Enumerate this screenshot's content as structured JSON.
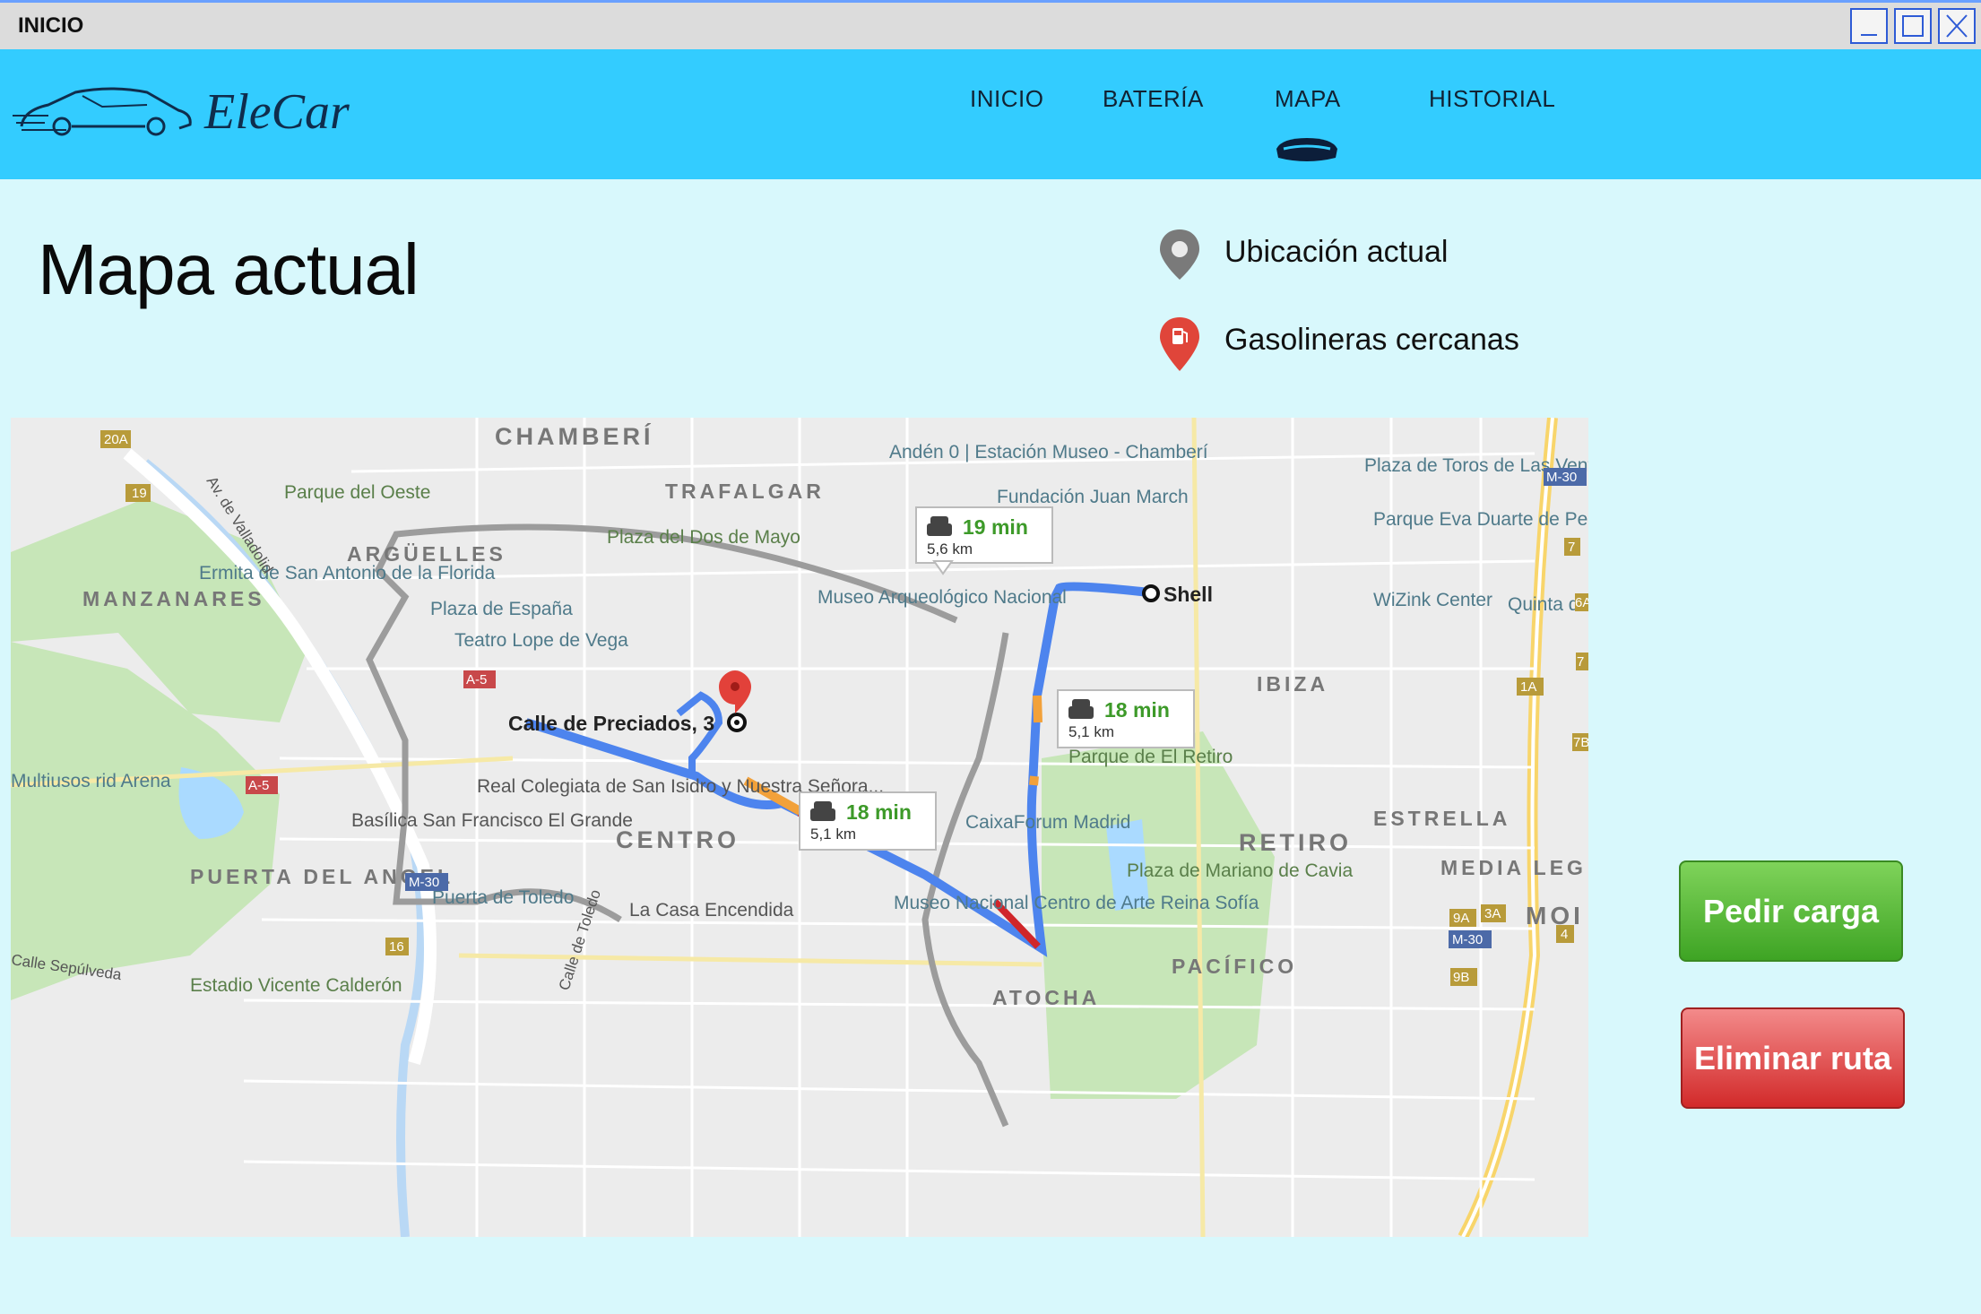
{
  "window": {
    "title": "INICIO"
  },
  "header": {
    "brand": "EleCar",
    "nav": [
      "INICIO",
      "BATERÍA",
      "MAPA",
      "HISTORIAL"
    ],
    "active_nav": "MAPA"
  },
  "page": {
    "title": "Mapa actual"
  },
  "legend": [
    {
      "label": "Ubicación actual",
      "icon": "gray-map-pin-icon"
    },
    {
      "label": "Gasolineras cercanas",
      "icon": "red-gas-station-pin-icon"
    }
  ],
  "map": {
    "districts": [
      "CHAMBERÍ",
      "TRAFALGAR",
      "ARGÜELLES",
      "MANZANARES",
      "CENTRO",
      "PUERTA DEL ANGEL",
      "IBIZA",
      "ESTRELLA",
      "RETIRO",
      "MEDIA LEG",
      "PACÍFICO",
      "ATOCHA",
      "MOI"
    ],
    "places": [
      "Andén 0 | Estación Museo - Chamberí",
      "Fundación Juan March",
      "Plaza de Toros de Las Ventas",
      "Parque Eva Duarte de Perón",
      "Parque del Oeste",
      "Ermita de San Antonio de la Florida",
      "Plaza del Dos de Mayo",
      "Museo Arqueológico Nacional",
      "WiZink Center",
      "Quinta d la Fuent del Berr",
      "Plaza de España",
      "Teatro Lope de Vega",
      "Parque de El Retiro",
      "Real Colegiata de San Isidro y Nuestra Señora...",
      "Basílica San Francisco El Grande",
      "CaixaForum Madrid",
      "Multiusos rid Arena",
      "Puerta de Toledo",
      "La Casa Encendida",
      "Museo Nacional Centro de Arte Reina Sofía",
      "Plaza de Mariano de Cavia",
      "Estadio Vicente Calderón",
      "Av. de Valladolid",
      "Calle Sepúlveda",
      "Calle de Toledo"
    ],
    "road_labels": [
      "20A",
      "19",
      "A-5",
      "A-5",
      "M-30",
      "16",
      "M-30",
      "7",
      "6A",
      "7",
      "1A",
      "7B",
      "9A",
      "3A",
      "M-30",
      "4",
      "9B"
    ],
    "origin_label": "Calle de Preciados, 3",
    "destination_label": "Shell",
    "route_badges": [
      {
        "time": "19 min",
        "distance": "5,6 km"
      },
      {
        "time": "18 min",
        "distance": "5,1 km"
      },
      {
        "time": "18 min",
        "distance": "5,1 km"
      }
    ]
  },
  "actions": {
    "request_charge": "Pedir carga",
    "delete_route": "Eliminar ruta"
  }
}
